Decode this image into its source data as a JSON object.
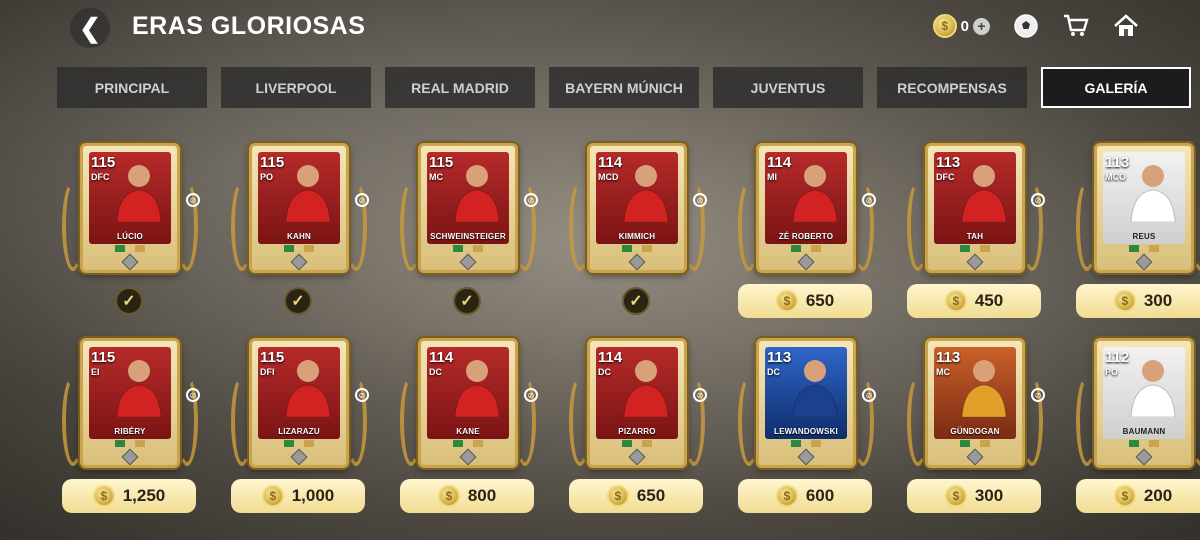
{
  "header": {
    "title": "ERAS GLORIOSAS",
    "coins": "0"
  },
  "tabs": [
    {
      "label": "PRINCIPAL"
    },
    {
      "label": "LIVERPOOL"
    },
    {
      "label": "REAL MADRID"
    },
    {
      "label": "BAYERN MÚNICH"
    },
    {
      "label": "JUVENTUS"
    },
    {
      "label": "RECOMPENSAS"
    },
    {
      "label": "GALERÍA",
      "active": true
    }
  ],
  "row1": [
    {
      "rating": "115",
      "pos": "DFC",
      "name": "LÚCIO",
      "style": "red",
      "owned": true
    },
    {
      "rating": "115",
      "pos": "PO",
      "name": "KAHN",
      "style": "red",
      "owned": true
    },
    {
      "rating": "115",
      "pos": "MC",
      "name": "SCHWEINSTEIGER",
      "style": "red",
      "owned": true
    },
    {
      "rating": "114",
      "pos": "MCD",
      "name": "KIMMICH",
      "style": "red",
      "owned": true
    },
    {
      "rating": "114",
      "pos": "MI",
      "name": "ZÉ ROBERTO",
      "style": "red",
      "owned": false,
      "price": "650"
    },
    {
      "rating": "113",
      "pos": "DFC",
      "name": "TAH",
      "style": "red",
      "owned": false,
      "price": "450"
    },
    {
      "rating": "113",
      "pos": "MCO",
      "name": "REUS",
      "style": "white",
      "owned": false,
      "price": "300"
    }
  ],
  "row2": [
    {
      "rating": "115",
      "pos": "EI",
      "name": "RIBÉRY",
      "style": "red",
      "owned": false,
      "price": "1,250"
    },
    {
      "rating": "115",
      "pos": "DFI",
      "name": "LIZARAZU",
      "style": "red",
      "owned": false,
      "price": "1,000"
    },
    {
      "rating": "114",
      "pos": "DC",
      "name": "KANE",
      "style": "red",
      "owned": false,
      "price": "800"
    },
    {
      "rating": "114",
      "pos": "DC",
      "name": "PIZARRO",
      "style": "red",
      "owned": false,
      "price": "650"
    },
    {
      "rating": "113",
      "pos": "DC",
      "name": "LEWANDOWSKI",
      "style": "blue",
      "owned": false,
      "price": "600"
    },
    {
      "rating": "113",
      "pos": "MC",
      "name": "GÜNDOGAN",
      "style": "orange",
      "owned": false,
      "price": "300"
    },
    {
      "rating": "112",
      "pos": "PO",
      "name": "BAUMANN",
      "style": "white",
      "owned": false,
      "price": "200"
    }
  ]
}
